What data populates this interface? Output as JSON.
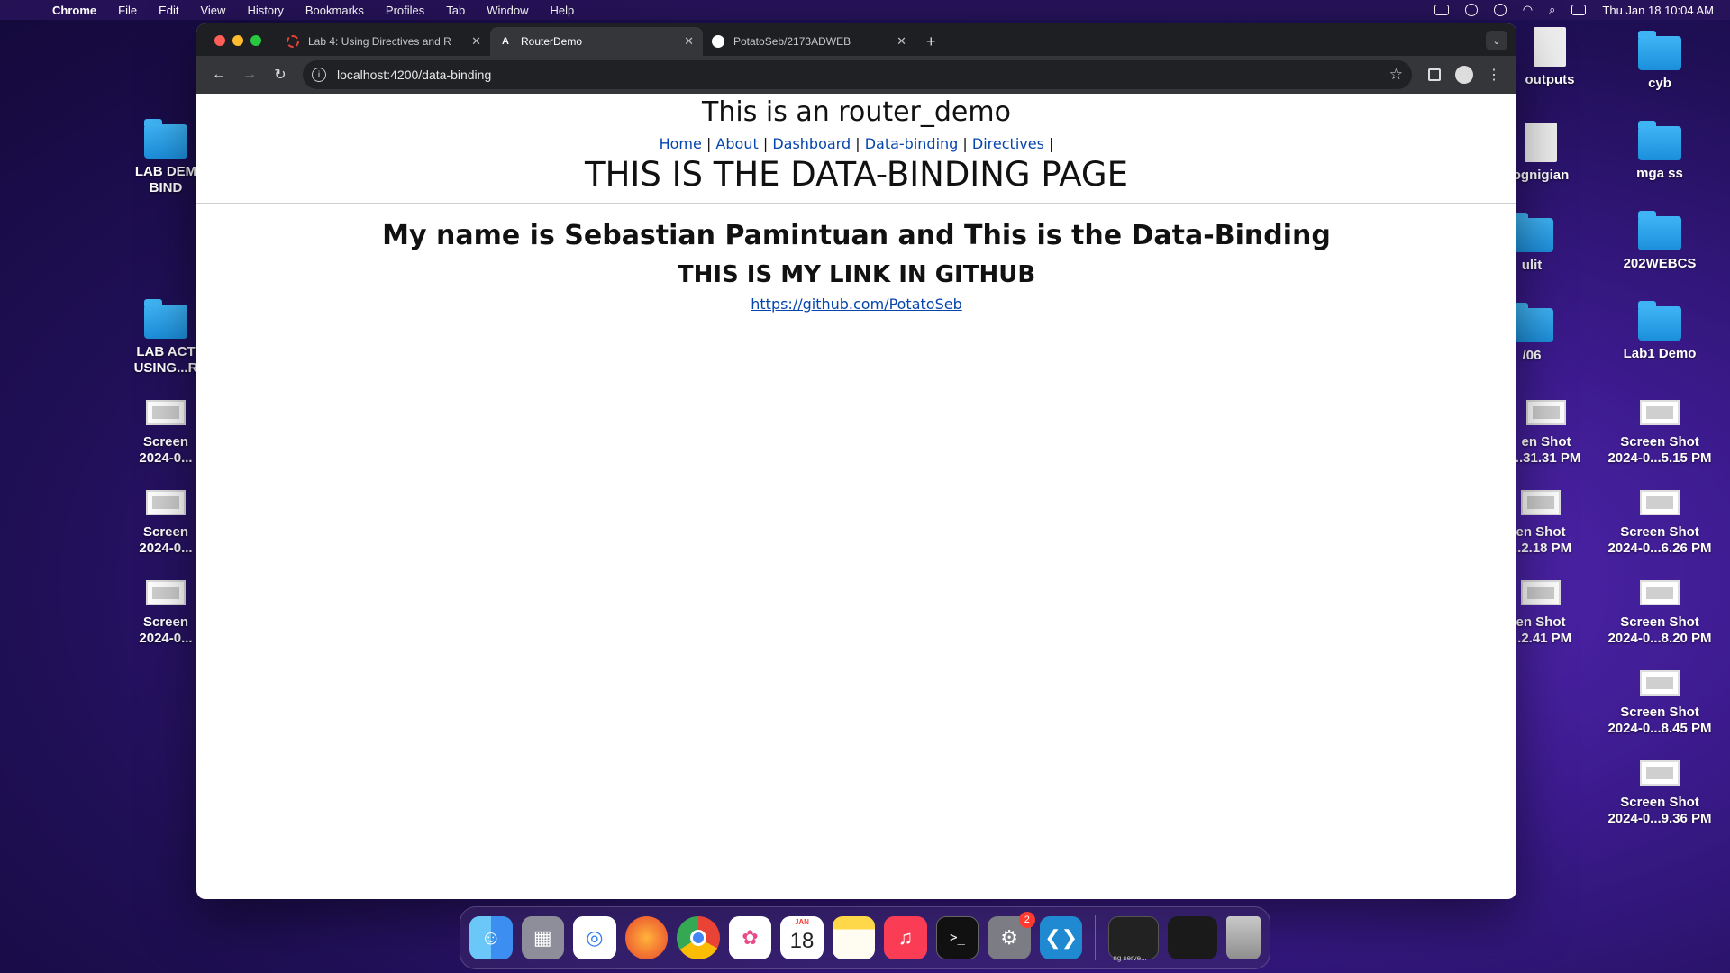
{
  "menubar": {
    "app_name": "Chrome",
    "menus": [
      "File",
      "Edit",
      "View",
      "History",
      "Bookmarks",
      "Profiles",
      "Tab",
      "Window",
      "Help"
    ],
    "clock": "Thu Jan 18  10:04 AM"
  },
  "desktop": {
    "left_icons": [
      {
        "label": "LAB DEM\nBIND",
        "kind": "folder"
      },
      {
        "label": "LAB ACT\nUSING...R",
        "kind": "folder"
      },
      {
        "label": "Screen\n2024-0...",
        "kind": "screenshot"
      },
      {
        "label": "Screen\n2024-0...",
        "kind": "screenshot"
      },
      {
        "label": "Screen\n2024-0...",
        "kind": "screenshot"
      }
    ],
    "mid_icons": [
      {
        "label": "outputs",
        "kind": "doc"
      },
      {
        "label": "ognigian",
        "kind": "doc"
      },
      {
        "label": "ulit",
        "kind": "folder"
      },
      {
        "label": "/06",
        "kind": "folder"
      },
      {
        "label": "en Shot\n...31.31 PM",
        "kind": "screenshot"
      },
      {
        "label": "en Shot\n...2.18 PM",
        "kind": "screenshot"
      },
      {
        "label": "en Shot\n...2.41 PM",
        "kind": "screenshot"
      }
    ],
    "right_icons": [
      {
        "label": "cyb",
        "kind": "folder"
      },
      {
        "label": "mga ss",
        "kind": "folder"
      },
      {
        "label": "202WEBCS",
        "kind": "folder"
      },
      {
        "label": "Lab1 Demo",
        "kind": "folder"
      },
      {
        "label": "Screen Shot\n2024-0...5.15 PM",
        "kind": "screenshot"
      },
      {
        "label": "Screen Shot\n2024-0...6.26 PM",
        "kind": "screenshot"
      },
      {
        "label": "Screen Shot\n2024-0...8.20 PM",
        "kind": "screenshot"
      },
      {
        "label": "Screen Shot\n2024-0...8.45 PM",
        "kind": "screenshot"
      },
      {
        "label": "Screen Shot\n2024-0...9.36 PM",
        "kind": "screenshot"
      }
    ]
  },
  "browser": {
    "tabs": [
      {
        "title": "Lab 4: Using Directives and R",
        "favicon": "lab-favicon-icon",
        "active": false
      },
      {
        "title": "RouterDemo",
        "favicon": "angular-icon",
        "active": true
      },
      {
        "title": "PotatoSeb/2173ADWEB",
        "favicon": "github-icon",
        "active": false
      }
    ],
    "url": "localhost:4200/data-binding"
  },
  "page": {
    "site_title": "This is an router_demo",
    "nav": [
      "Home",
      "About",
      "Dashboard",
      "Data-binding",
      "Directives"
    ],
    "nav_separator": "|",
    "page_heading": "THIS IS THE DATA-BINDING PAGE",
    "intro": "My name is Sebastian Pamintuan and This is the Data-Binding",
    "github_heading": "THIS IS MY LINK IN GITHUB",
    "github_link": "https://github.com/PotatoSeb"
  },
  "dock": {
    "apps": [
      "finder-icon",
      "launchpad-icon",
      "safari-icon",
      "firefox-icon",
      "chrome-icon",
      "photos-icon",
      "calendar-icon",
      "notes-icon",
      "music-icon",
      "terminal-icon",
      "system-settings-icon",
      "vscode-icon"
    ],
    "calendar_month": "JAN",
    "calendar_day": "18",
    "settings_badge": "2",
    "minimized_label": "ng serve..."
  }
}
